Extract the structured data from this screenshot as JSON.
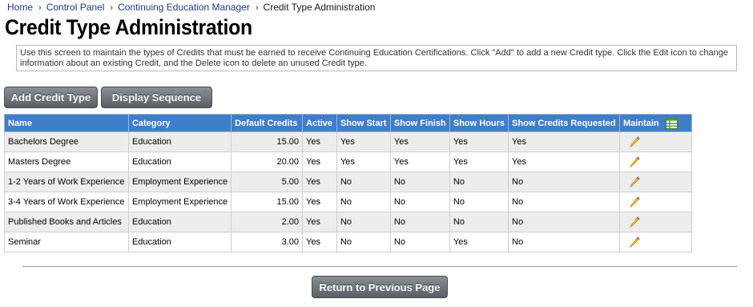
{
  "breadcrumb": {
    "items": [
      "Home",
      "Control Panel",
      "Continuing Education Manager"
    ],
    "current": "Credit Type Administration",
    "separator": "›"
  },
  "page_title": "Credit Type Administration",
  "instructions": "Use this screen to maintain the types of Credits that must be earned to receive Continuing Education Certifications. Click \"Add\" to add a new Credit type. Click the Edit icon to change information about an existing Credit, and the Delete icon to delete an unused Credit type.",
  "buttons": {
    "add": "Add Credit Type",
    "sequence": "Display Sequence",
    "return": "Return to Previous Page"
  },
  "table": {
    "headers": [
      "Name",
      "Category",
      "Default Credits",
      "Active",
      "Show Start",
      "Show Finish",
      "Show Hours",
      "Show Credits Requested",
      "Maintain"
    ],
    "rows": [
      [
        "Bachelors Degree",
        "Education",
        "15.00",
        "Yes",
        "Yes",
        "Yes",
        "Yes",
        "Yes"
      ],
      [
        "Masters Degree",
        "Education",
        "20.00",
        "Yes",
        "Yes",
        "Yes",
        "Yes",
        "Yes"
      ],
      [
        "1-2 Years of Work Experience",
        "Employment Experience",
        "5.00",
        "Yes",
        "No",
        "No",
        "No",
        "No"
      ],
      [
        "3-4 Years of Work Experience",
        "Employment Experience",
        "15.00",
        "Yes",
        "No",
        "No",
        "No",
        "No"
      ],
      [
        "Published Books and Articles",
        "Education",
        "2.00",
        "Yes",
        "No",
        "No",
        "No",
        "No"
      ],
      [
        "Seminar",
        "Education",
        "3.00",
        "Yes",
        "No",
        "No",
        "Yes",
        "No"
      ]
    ],
    "maintain_icon": "edit-pencil-icon",
    "header_icon": "export-grid-icon"
  },
  "colors": {
    "header_bg": "#3f7ec9",
    "link": "#1f3a8f",
    "button": "#6b6f76",
    "row_alt": "#ededed"
  }
}
